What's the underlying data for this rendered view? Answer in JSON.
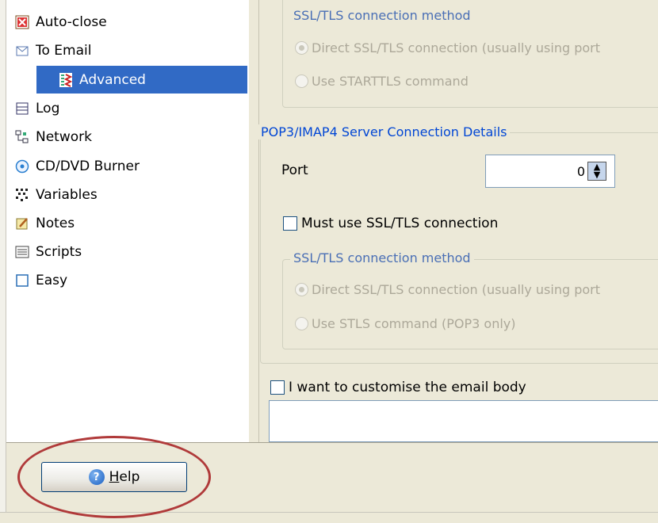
{
  "tree": {
    "items": [
      {
        "label": "Auto-close",
        "icon": "auto-close-icon"
      },
      {
        "label": "To Email",
        "icon": "email-icon"
      },
      {
        "label": "Advanced",
        "icon": "advanced-icon",
        "selected": true
      },
      {
        "label": "Log",
        "icon": "log-icon"
      },
      {
        "label": "Network",
        "icon": "network-icon"
      },
      {
        "label": "CD/DVD Burner",
        "icon": "cd-dvd-icon"
      },
      {
        "label": "Variables",
        "icon": "variables-icon"
      },
      {
        "label": "Notes",
        "icon": "notes-icon"
      },
      {
        "label": "Scripts",
        "icon": "scripts-icon"
      },
      {
        "label": "Easy",
        "icon": "easy-icon"
      }
    ]
  },
  "smtp_ssl": {
    "title": "SSL/TLS connection method",
    "option_direct": "Direct SSL/TLS connection (usually using port",
    "option_starttls": "Use STARTTLS command"
  },
  "pop3": {
    "group_title": "POP3/IMAP4 Server Connection Details",
    "port_label": "Port",
    "port_value": "0",
    "must_ssl_label": "Must use SSL/TLS connection",
    "ssl_title": "SSL/TLS connection method",
    "option_direct": "Direct SSL/TLS connection (usually using port",
    "option_stls": "Use STLS command (POP3 only)"
  },
  "email_body": {
    "checkbox_label": "I want to customise the email body"
  },
  "footer": {
    "help_label_underlined": "H",
    "help_label_rest": "elp"
  },
  "colors": {
    "selection": "#316ac5",
    "group_title": "#0046d5",
    "highlight_ring": "#b03a3a"
  }
}
